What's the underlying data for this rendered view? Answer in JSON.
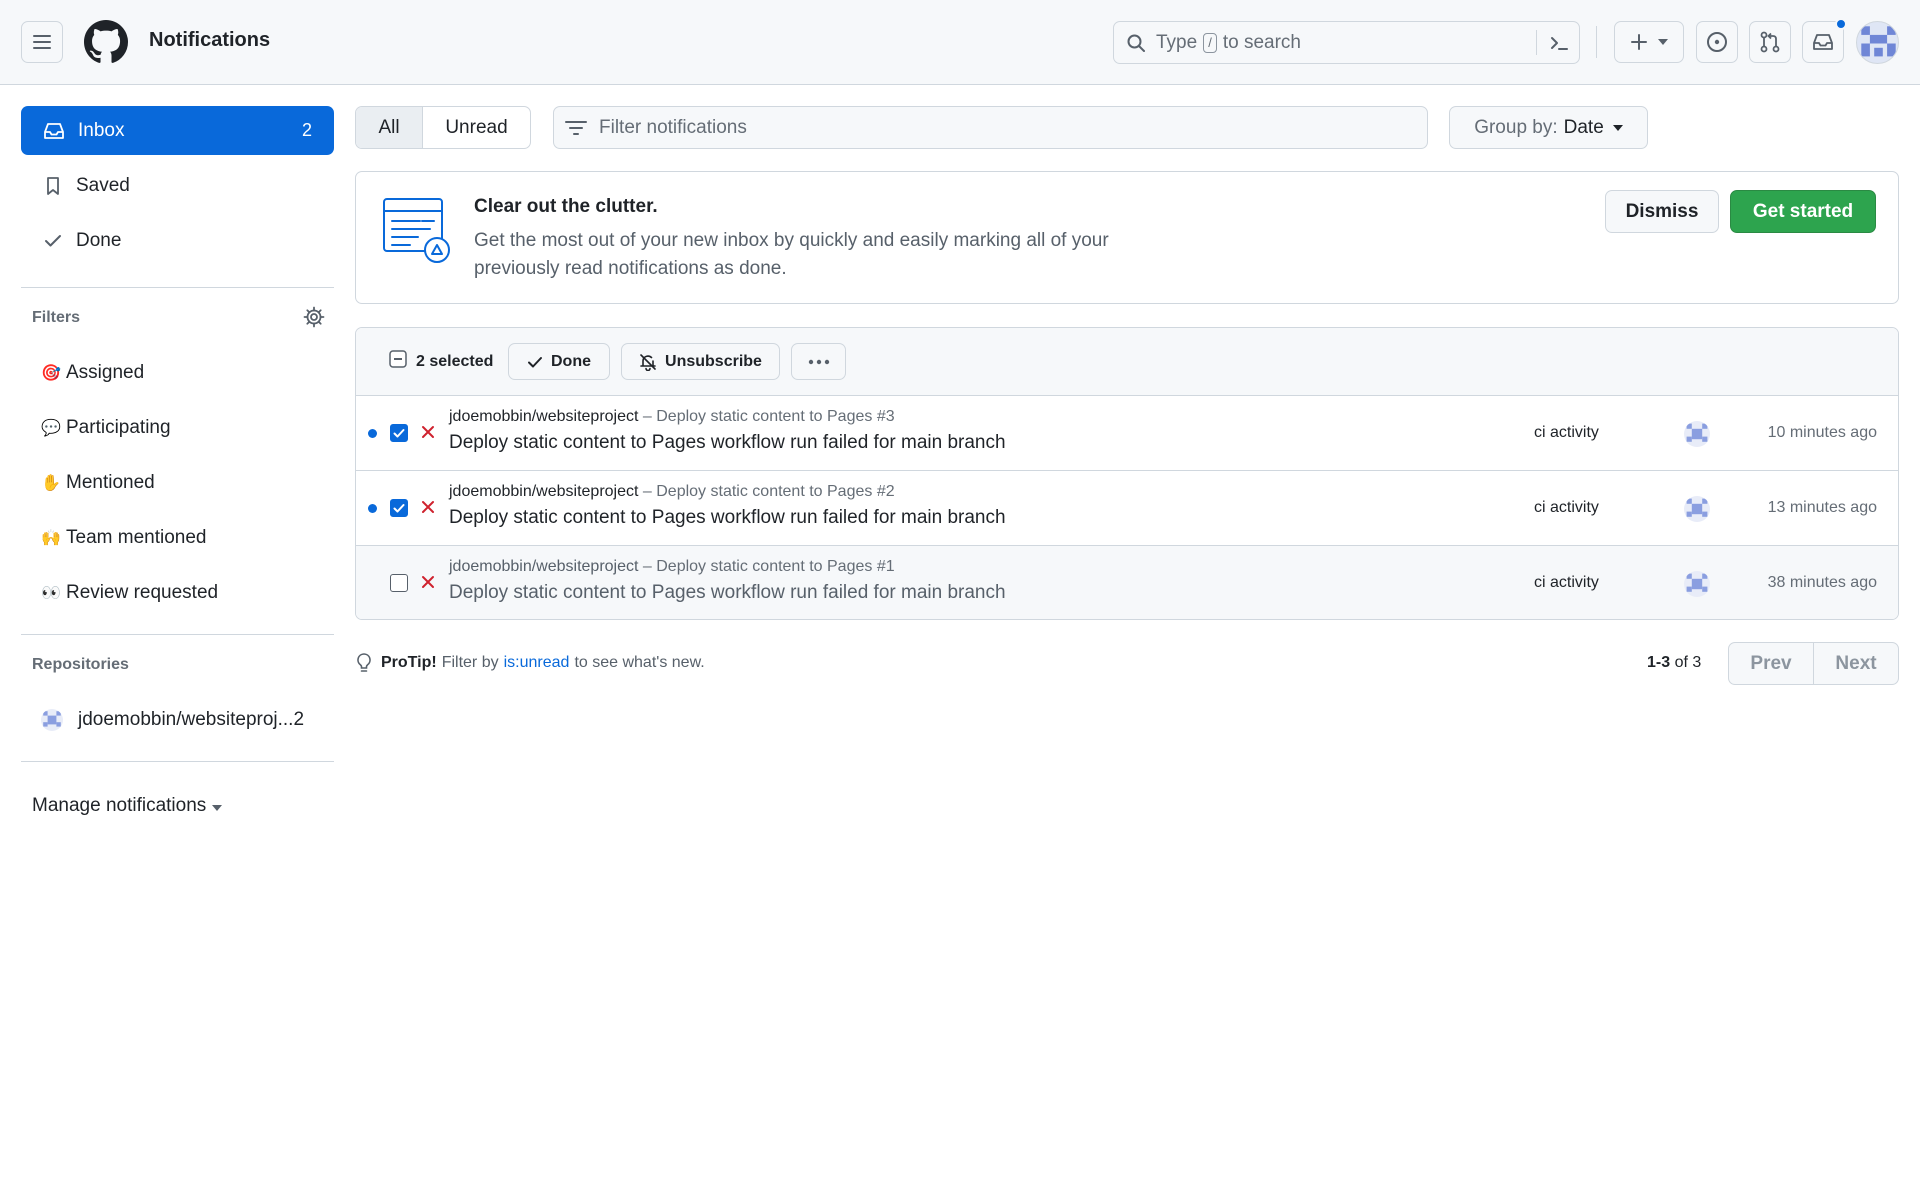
{
  "header": {
    "title": "Notifications",
    "search": {
      "pre": "Type",
      "key": "/",
      "post": "to search"
    }
  },
  "sidebar": {
    "inbox": {
      "label": "Inbox",
      "count": "2"
    },
    "saved": "Saved",
    "done": "Done",
    "filters_heading": "Filters",
    "filters": [
      {
        "emoji": "🎯",
        "label": "Assigned"
      },
      {
        "emoji": "💬",
        "label": "Participating"
      },
      {
        "emoji": "✋",
        "label": "Mentioned"
      },
      {
        "emoji": "🙌",
        "label": "Team mentioned"
      },
      {
        "emoji": "👀",
        "label": "Review requested"
      }
    ],
    "repos_heading": "Repositories",
    "repo": {
      "name": "jdoemobbin/websiteproj...",
      "count": "2"
    },
    "manage": "Manage notifications"
  },
  "toolbar": {
    "all": "All",
    "unread": "Unread",
    "filter_placeholder": "Filter notifications",
    "group_label": "Group by:",
    "group_value": "Date"
  },
  "banner": {
    "title": "Clear out the clutter.",
    "line1": "Get the most out of your new inbox by quickly and easily marking all of your",
    "line2": "previously read notifications as done.",
    "dismiss": "Dismiss",
    "get_started": "Get started"
  },
  "list": {
    "selected": "2 selected",
    "done": "Done",
    "unsubscribe": "Unsubscribe",
    "rows": [
      {
        "repo": "jdoemobbin/websiteproject",
        "sub": "– Deploy static content to Pages #3",
        "title": "Deploy static content to Pages workflow run failed for main branch",
        "reason": "ci activity",
        "time": "10 minutes ago"
      },
      {
        "repo": "jdoemobbin/websiteproject",
        "sub": "– Deploy static content to Pages #2",
        "title": "Deploy static content to Pages workflow run failed for main branch",
        "reason": "ci activity",
        "time": "13 minutes ago"
      },
      {
        "repo": "jdoemobbin/websiteproject",
        "sub": "– Deploy static content to Pages #1",
        "title": "Deploy static content to Pages workflow run failed for main branch",
        "reason": "ci activity",
        "time": "38 minutes ago"
      }
    ]
  },
  "footer": {
    "protip": "ProTip!",
    "tip_pre": "Filter by",
    "tip_link": "is:unread",
    "tip_post": "to see what's new.",
    "range": "1-3",
    "of": "of 3",
    "prev": "Prev",
    "next": "Next"
  },
  "colors": {
    "accent": "#0969da",
    "success": "#2da44e",
    "danger": "#cf222e"
  }
}
